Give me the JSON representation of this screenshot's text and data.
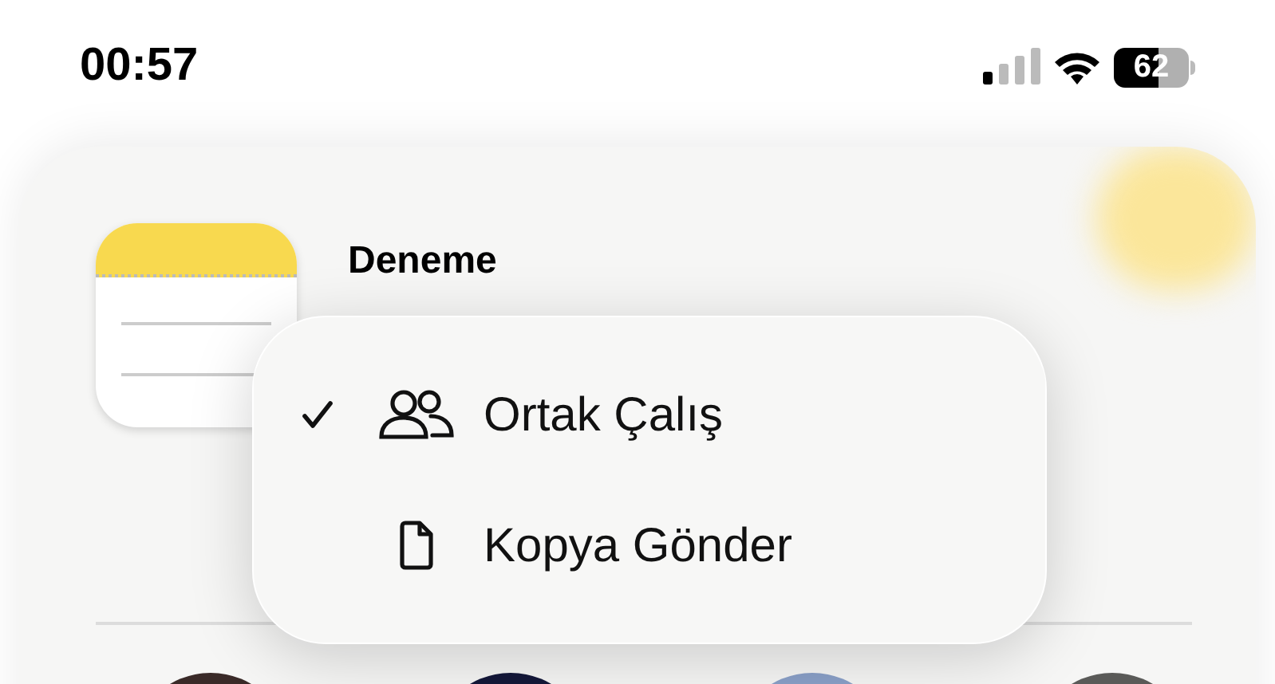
{
  "status_bar": {
    "time": "00:57",
    "battery": "62"
  },
  "note": {
    "title": "Deneme"
  },
  "menu": {
    "items": [
      {
        "label": "Ortak Çalış",
        "kind": "people",
        "checked": true
      },
      {
        "label": "Kopya Gönder",
        "kind": "document",
        "checked": false
      }
    ]
  },
  "contacts": [
    {
      "color": "#3a2a28"
    },
    {
      "color": "#14183a"
    },
    {
      "color": "#8aa0c8"
    },
    {
      "color": "#5a5a58"
    }
  ]
}
